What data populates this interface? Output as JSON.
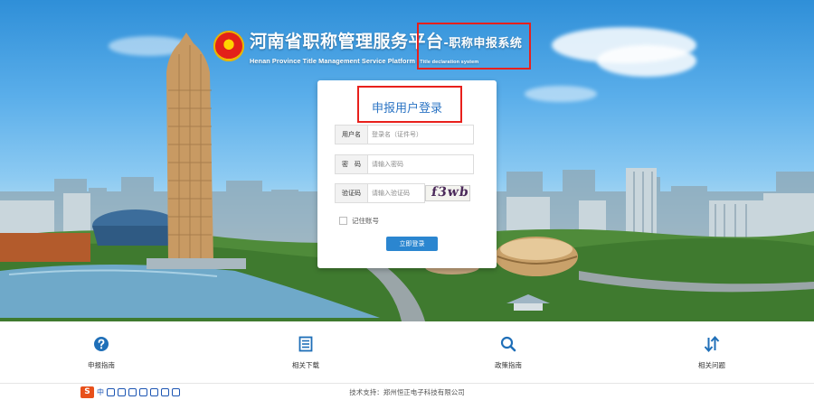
{
  "header": {
    "title": "河南省职称管理服务平台",
    "subtitle": "-职称申报系统",
    "title_en": "Henan Province Title Management Service Platform",
    "subtitle_en": " - Title declaration system"
  },
  "login": {
    "title": "申报用户登录",
    "username_label": "用户名",
    "username_placeholder": "登录名（证件号）",
    "password_label": "密　码",
    "password_placeholder": "请输入密码",
    "captcha_label": "验证码",
    "captcha_placeholder": "请输入验证码",
    "captcha_text": "f3wb",
    "remember_label": "记住账号",
    "submit_label": "立即登录"
  },
  "nav": {
    "items": [
      {
        "label": "申报指南",
        "icon": "question-circle-icon"
      },
      {
        "label": "相关下载",
        "icon": "document-list-icon"
      },
      {
        "label": "政策指南",
        "icon": "search-icon"
      },
      {
        "label": "相关问题",
        "icon": "sort-arrows-icon"
      }
    ]
  },
  "footer": {
    "tech_support": "技术支持：郑州恒正电子科技有限公司",
    "ime_brand": "S",
    "ime_mode": "中"
  },
  "colors": {
    "accent": "#2b86d0",
    "title_blue": "#2b74c4",
    "highlight_red": "#e8201c",
    "icon_blue": "#1f6fb8"
  }
}
